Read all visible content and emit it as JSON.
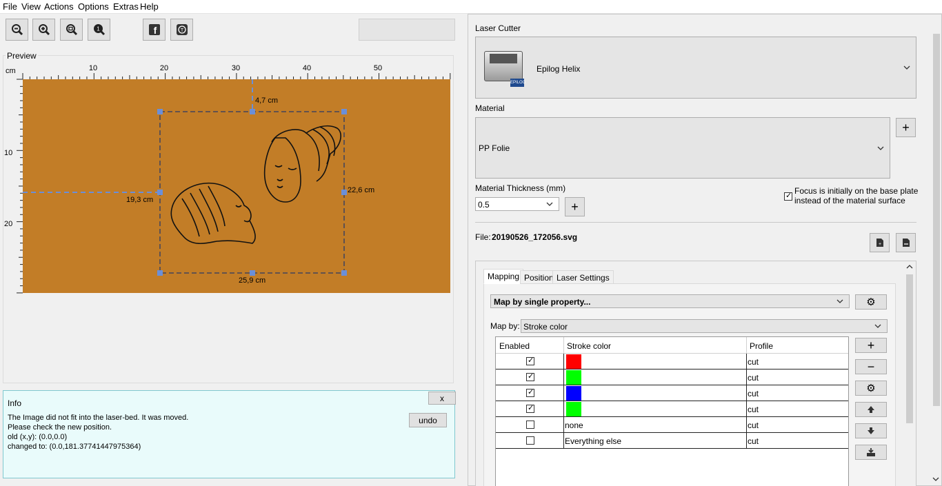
{
  "menu": [
    "File",
    "View",
    "Actions",
    "Options",
    "Extras",
    "Help"
  ],
  "toolbar": {
    "icons": [
      "zoom-out-icon",
      "zoom-in-icon",
      "zoom-fit-icon",
      "zoom-reset-icon",
      "facebook-icon",
      "twitter-icon"
    ]
  },
  "preview": {
    "title": "Preview",
    "unit": "cm",
    "ruler_x": [
      "10",
      "20",
      "30",
      "40",
      "50"
    ],
    "ruler_y": [
      "10",
      "20"
    ],
    "bed_color": "#c27d27",
    "dim_top": "4,7 cm",
    "dim_left": "19,3 cm",
    "dim_right": "22,6 cm",
    "dim_bottom": "25,9 cm"
  },
  "info": {
    "title": "Info",
    "close_label": "x",
    "undo_label": "undo",
    "line1": "The Image did not fit into the laser-bed. It was moved.",
    "line2": "Please check the new position.",
    "line3": "old (x,y): (0.0,0.0)",
    "line4": "changed to: (0.0,181.37741447975364)"
  },
  "laser": {
    "label": "Laser Cutter",
    "name": "Epilog Helix",
    "logo_text": "EPILOG"
  },
  "material": {
    "label": "Material",
    "value": "PP Folie",
    "add_label": "+"
  },
  "thickness": {
    "label": "Material Thickness (mm)",
    "value": "0.5",
    "add_label": "+",
    "focus_line1": "Focus is initially on the base plate",
    "focus_line2": "instead of the material surface"
  },
  "file": {
    "label": "File:",
    "name": "20190526_172056.svg"
  },
  "tabs": [
    "Mapping",
    "Position",
    "Laser Settings"
  ],
  "mapping": {
    "mode": "Map by single property...",
    "map_by_label": "Map by:",
    "map_by_value": "Stroke color",
    "headers": [
      "Enabled",
      "Stroke color",
      "Profile"
    ],
    "rows": [
      {
        "enabled": true,
        "color": "#ff0000",
        "label": "",
        "profile": "cut"
      },
      {
        "enabled": true,
        "color": "#00ff00",
        "label": "",
        "profile": "cut"
      },
      {
        "enabled": true,
        "color": "#0000ff",
        "label": "",
        "profile": "cut"
      },
      {
        "enabled": true,
        "color": "#00ff00",
        "label": "",
        "profile": "cut"
      },
      {
        "enabled": false,
        "color": "",
        "label": "none",
        "profile": "cut"
      },
      {
        "enabled": false,
        "color": "",
        "label": "Everything else",
        "profile": "cut"
      }
    ],
    "side_buttons": [
      "plus-icon",
      "minus-icon",
      "gear-icon",
      "arrow-up-icon",
      "arrow-down-icon",
      "import-icon"
    ]
  }
}
